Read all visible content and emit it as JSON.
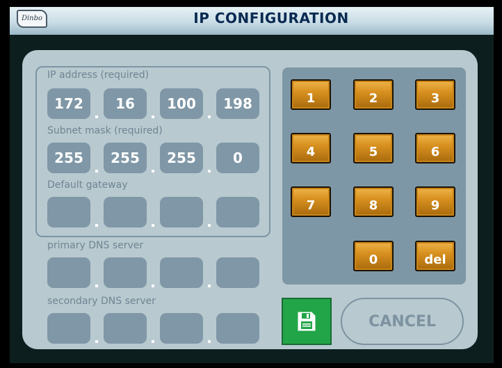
{
  "title": "IP CONFIGURATION",
  "logo_text": "Dinbo",
  "fields": [
    {
      "label": "IP address (required)",
      "octets": [
        "172",
        "16",
        "100",
        "198"
      ]
    },
    {
      "label": "Subnet mask (required)",
      "octets": [
        "255",
        "255",
        "255",
        "0"
      ]
    },
    {
      "label": "Default gateway",
      "octets": [
        "",
        "",
        "",
        ""
      ]
    },
    {
      "label": "primary DNS server",
      "octets": [
        "",
        "",
        "",
        ""
      ]
    },
    {
      "label": "secondary DNS server",
      "octets": [
        "",
        "",
        "",
        ""
      ]
    }
  ],
  "keypad": {
    "keys": [
      "1",
      "2",
      "3",
      "4",
      "5",
      "6",
      "7",
      "8",
      "9",
      "0",
      "del"
    ]
  },
  "buttons": {
    "save_icon": "floppy-disk-icon",
    "cancel_label": "CANCEL"
  },
  "colors": {
    "panel": "#b8c9d0",
    "octet": "#7f97a6",
    "key": "#d89120",
    "save": "#22a548",
    "title_text": "#0a2a52"
  }
}
